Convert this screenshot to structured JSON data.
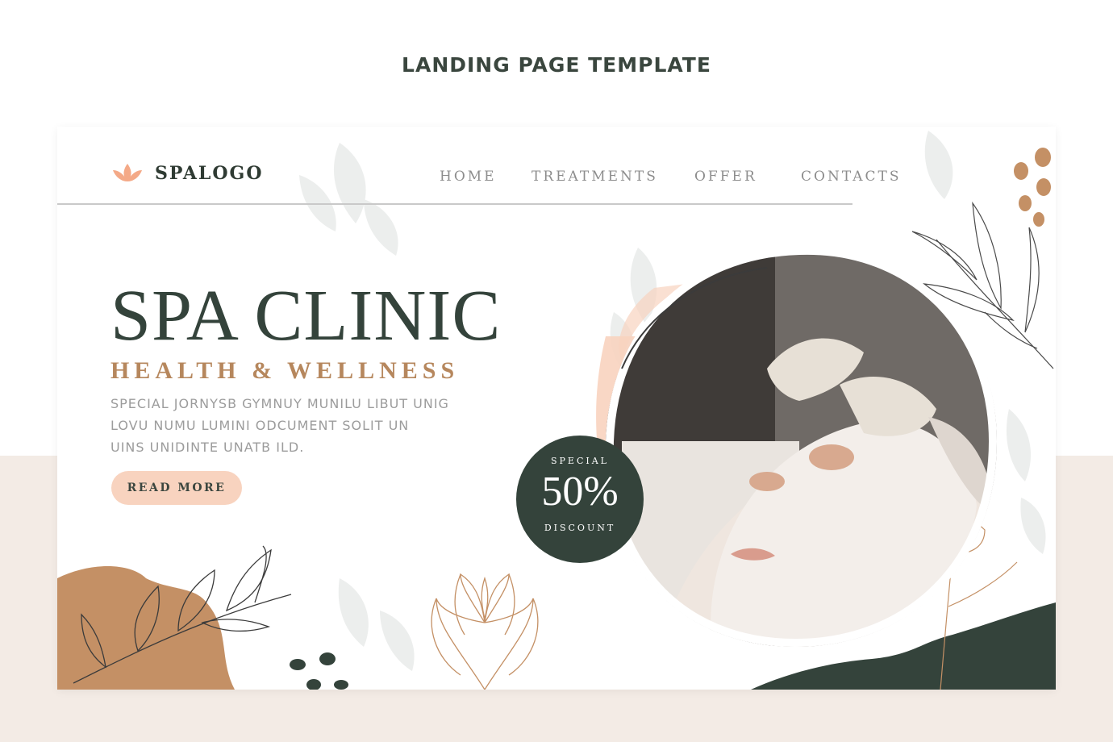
{
  "page": {
    "heading": "LANDING PAGE TEMPLATE"
  },
  "header": {
    "logo_icon": "lotus-icon",
    "logo_text": "SPALOGO",
    "nav": [
      {
        "label": "HOME"
      },
      {
        "label": "TREATMENTS"
      },
      {
        "label": "OFFER"
      },
      {
        "label": "CONTACTS"
      }
    ]
  },
  "hero": {
    "title": "SPA CLINIC",
    "subtitle": "HEALTH & WELLNESS",
    "description_lines": [
      "SPECIAL JORNYSB GYMNUY MUNILU LIBUT UNIG",
      "LOVU NUMU LUMINI ODCUMENT SOLIT UN",
      "UINS UNIDINTE UNATB ILD."
    ],
    "cta_label": "READ MORE"
  },
  "badge": {
    "top": "SPECIAL",
    "value": "50%",
    "bottom": "DISCOUNT"
  },
  "colors": {
    "dark_green": "#34433b",
    "brown": "#c49065",
    "peach": "#f8d3bf",
    "accent_text": "#b6875d",
    "muted_text": "#9c9c9c",
    "bottom_band": "#f3ebe5"
  }
}
